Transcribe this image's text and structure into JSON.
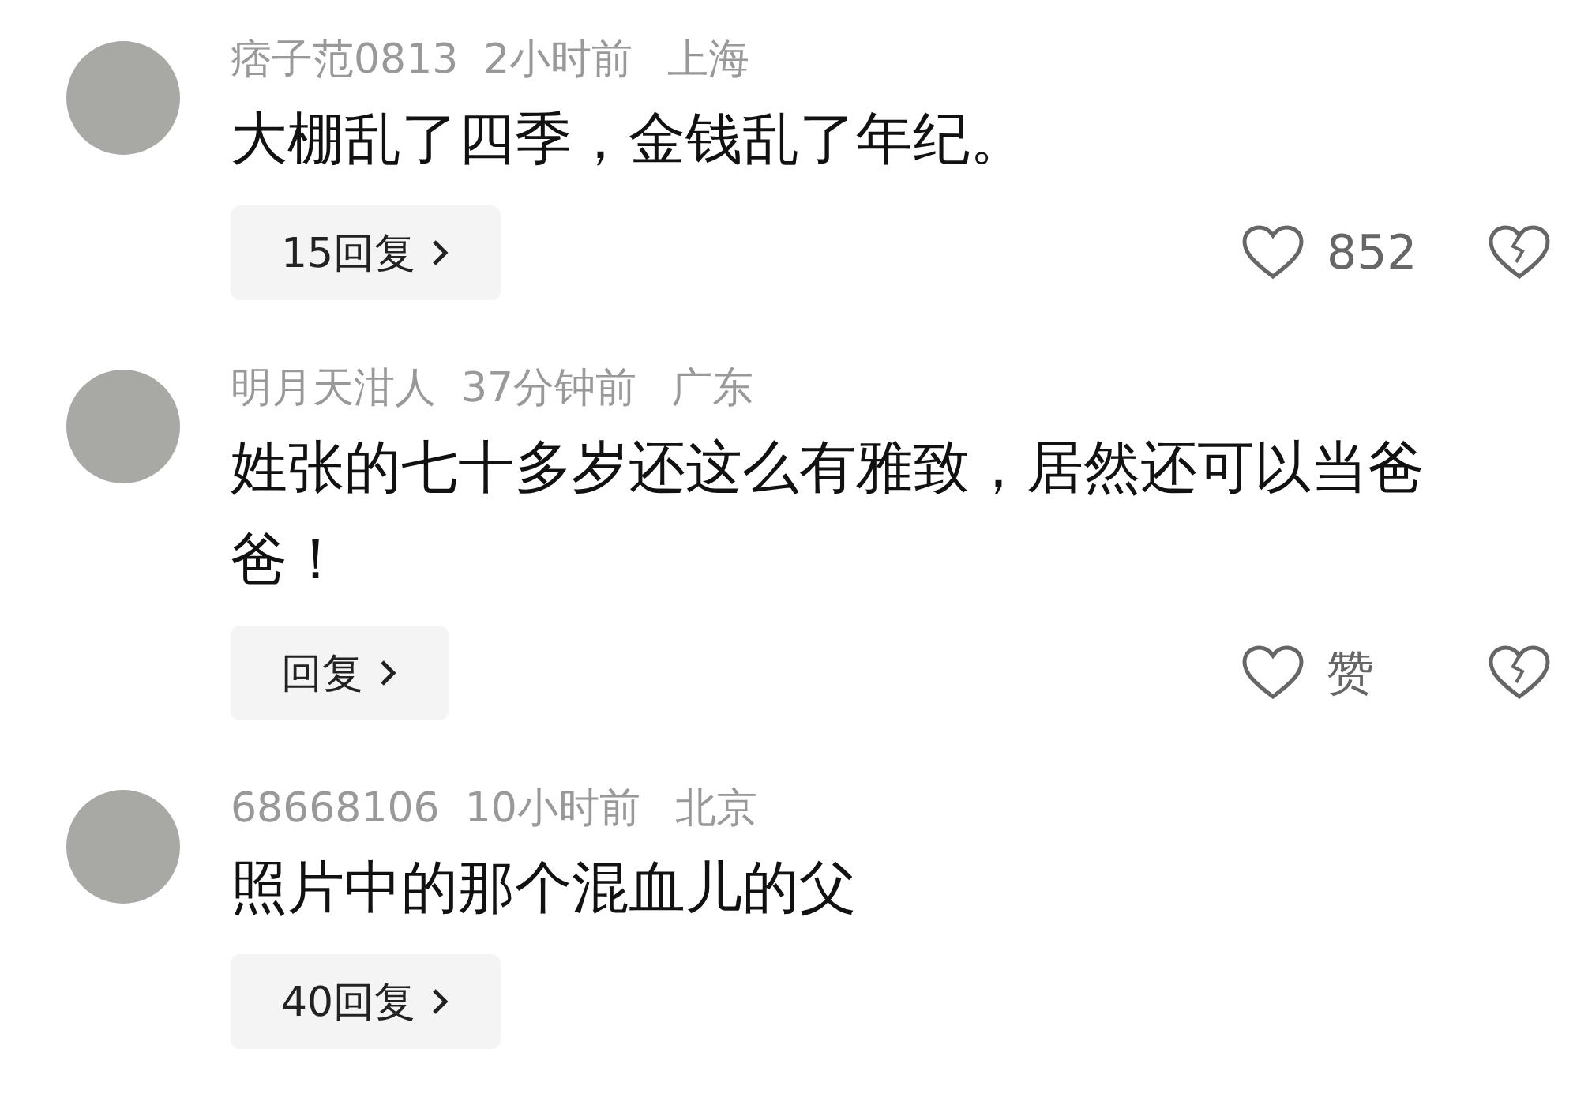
{
  "comments": [
    {
      "user": "痞子范0813",
      "time": "2小时前",
      "location": "上海",
      "text": "大棚乱了四季，金钱乱了年纪。",
      "reply_button": "15回复",
      "like_label": "852",
      "show_actions": true
    },
    {
      "user": "明月天泔人",
      "time": "37分钟前",
      "location": "广东",
      "text": "姓张的七十多岁还这么有雅致，居然还可以当爸爸！",
      "reply_button": "回复",
      "like_label": "赞",
      "show_actions": true
    },
    {
      "user": "68668106",
      "time": "10小时前",
      "location": "北京",
      "text": "照片中的那个混血儿的父",
      "reply_button": "40回复",
      "show_actions": false
    }
  ]
}
